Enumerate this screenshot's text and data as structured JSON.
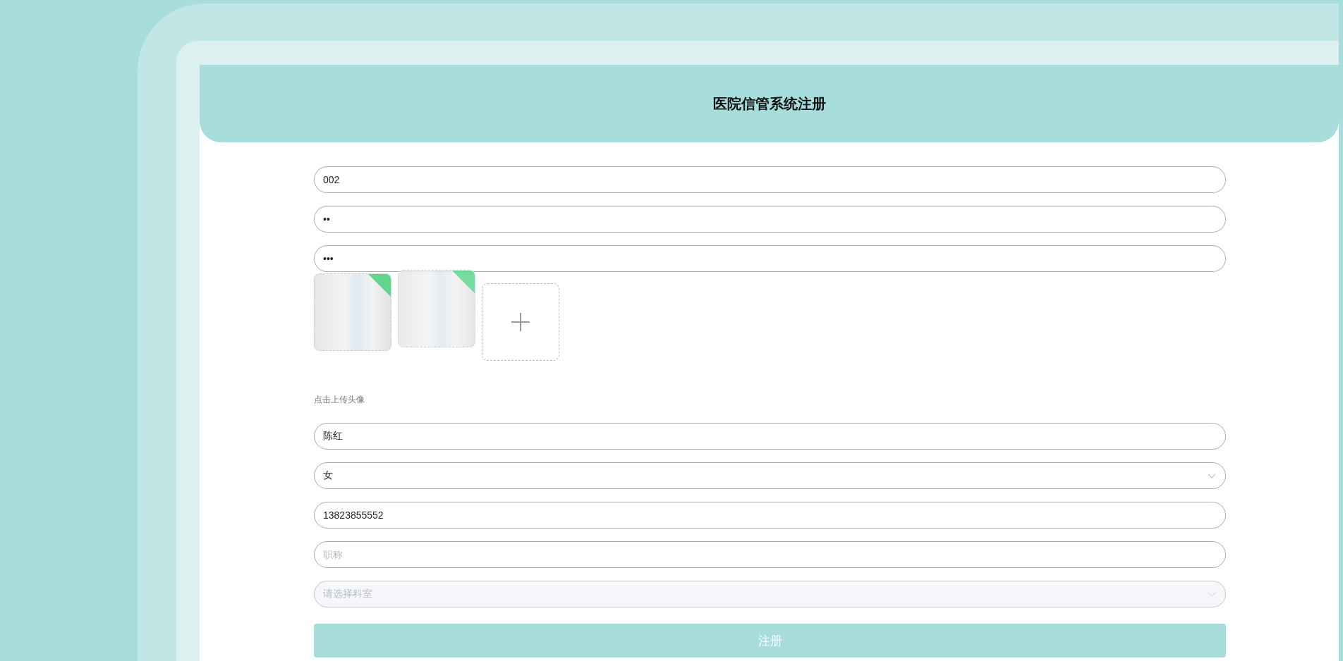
{
  "title": "医院信管系统注册",
  "fields_top": [
    {
      "kind": "input",
      "value": "002"
    },
    {
      "kind": "input",
      "value": "••"
    },
    {
      "kind": "input",
      "value": "•••"
    }
  ],
  "photos": [
    {
      "uploaded": true
    },
    {
      "uploaded": true
    }
  ],
  "upload_hint": "点击上传头像",
  "fields_bottom": [
    {
      "kind": "input",
      "value": "陈红"
    },
    {
      "kind": "select",
      "value": "女",
      "disabled": false
    },
    {
      "kind": "input",
      "value": "13823855552"
    },
    {
      "kind": "input",
      "placeholder": "职称"
    },
    {
      "kind": "select",
      "placeholder": "请选择科室",
      "disabled": true
    }
  ],
  "submit": {
    "label": "注册"
  }
}
